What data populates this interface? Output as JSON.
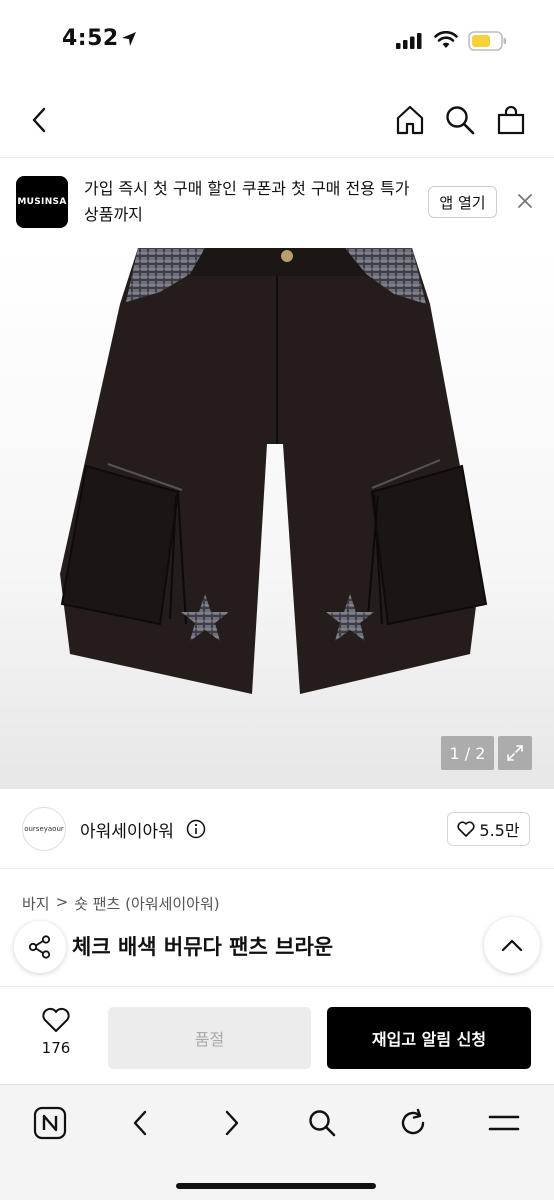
{
  "status_bar": {
    "time": "4:52"
  },
  "header": {
    "back_icon": "chevron-left-icon",
    "home_icon": "home-icon",
    "search_icon": "search-icon",
    "cart_icon": "shopping-bag-icon"
  },
  "banner": {
    "logo_text": "MUSINSA",
    "message": "가입 즉시 첫 구매 할인 쿠폰과 첫 구매 전용 특가 상품까지",
    "open_app_label": "앱 열기",
    "close_icon": "close-icon"
  },
  "product_image": {
    "counter": "1 / 2",
    "expand_icon": "expand-icon"
  },
  "brand": {
    "avatar_text": "ourseyaour",
    "name": "아워세이아워",
    "info_icon": "info-icon",
    "likes": "5.5만"
  },
  "breadcrumb": {
    "category": "바지",
    "separator": ">",
    "subcategory": "숏 팬츠 (아워세이아워)"
  },
  "product": {
    "title": "체크 배색 버뮤다 팬츠 브라운"
  },
  "purchase_bar": {
    "wish_count": "176",
    "soldout_label": "품절",
    "restock_label": "재입고 알림 신청"
  },
  "browser_bar": {
    "icons": [
      "naver-icon",
      "back-arrow-icon",
      "forward-arrow-icon",
      "search-icon",
      "refresh-icon",
      "menu-icon"
    ]
  },
  "colors": {
    "accent": "#000000",
    "soldout_bg": "#ececec",
    "battery": "#f5d23a"
  }
}
